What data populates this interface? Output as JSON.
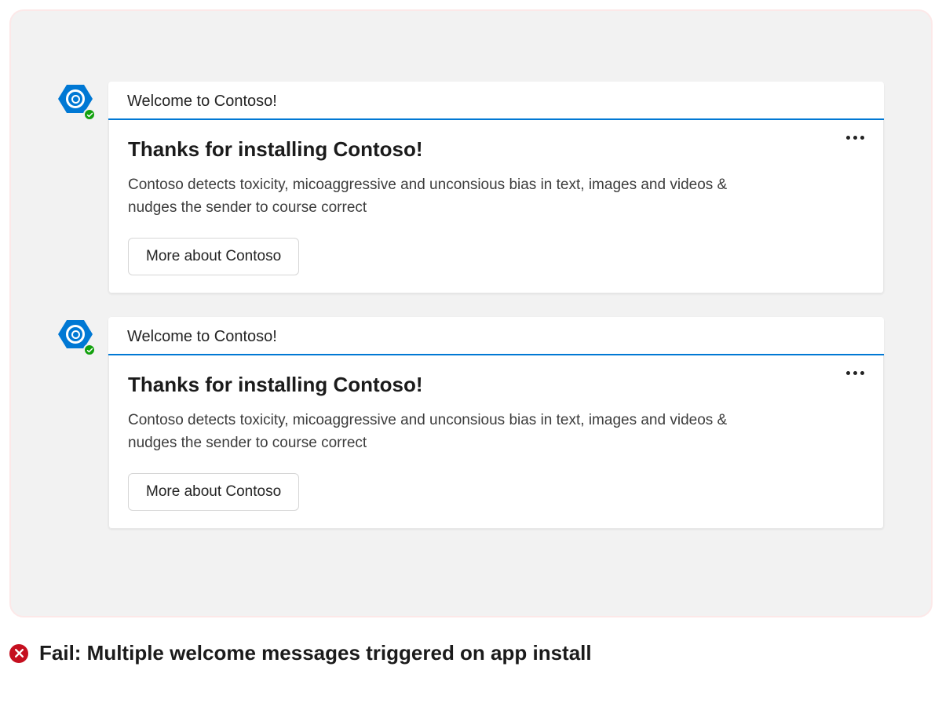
{
  "messages": [
    {
      "header": "Welcome to Contoso!",
      "title": "Thanks for installing Contoso!",
      "description": "Contoso detects toxicity, micoaggressive and unconsious bias in text, images and videos & nudges the sender to course correct",
      "action_label": "More about Contoso"
    },
    {
      "header": "Welcome to Contoso!",
      "title": "Thanks for installing Contoso!",
      "description": "Contoso detects toxicity, micoaggressive and unconsious bias in text, images and videos & nudges the sender to course correct",
      "action_label": "More about Contoso"
    }
  ],
  "verdict": {
    "text": "Fail: Multiple welcome messages triggered on app install"
  }
}
